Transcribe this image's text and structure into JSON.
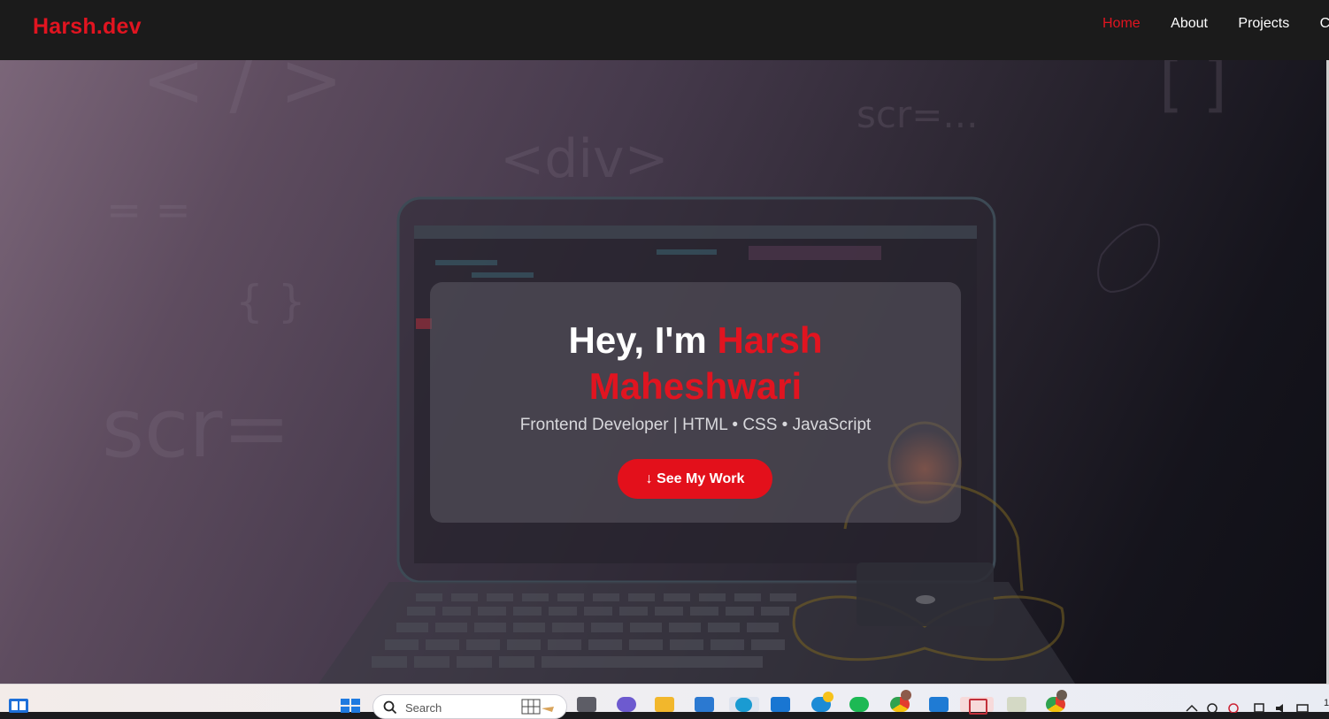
{
  "nav": {
    "logo": "Harsh.dev",
    "links": [
      {
        "label": "Home",
        "active": true
      },
      {
        "label": "About",
        "active": false
      },
      {
        "label": "Projects",
        "active": false
      },
      {
        "label": "Cor",
        "active": false
      }
    ]
  },
  "hero": {
    "greeting": "Hey, I'm ",
    "name_line1": "Harsh",
    "name_line2": "Maheshwari",
    "subtitle": "Frontend Developer | HTML • CSS • JavaScript",
    "cta_label": "↓ See My Work",
    "bg_code_glyphs": [
      "< / >",
      "<div>",
      "scr=...",
      "scr=",
      "= =",
      "{ }",
      "[ ]"
    ]
  },
  "taskbar": {
    "search_placeholder": "Search",
    "tray_time_fragment": "1",
    "icons": [
      "start-icon",
      "search-icon",
      "widgets-icon",
      "task-view-icon",
      "teams-icon",
      "file-explorer-icon",
      "store-icon",
      "edge-icon",
      "hp-icon",
      "app-icon",
      "spotify-icon",
      "chrome-icon",
      "vscode-icon",
      "snipping-icon",
      "notepad-icon",
      "chrome-profile-icon"
    ]
  },
  "colors": {
    "accent": "#e11420",
    "navbar_bg": "#1b1b1b",
    "card_bg": "rgba(92,90,100,0.55)",
    "button_bg": "#e3101b"
  }
}
